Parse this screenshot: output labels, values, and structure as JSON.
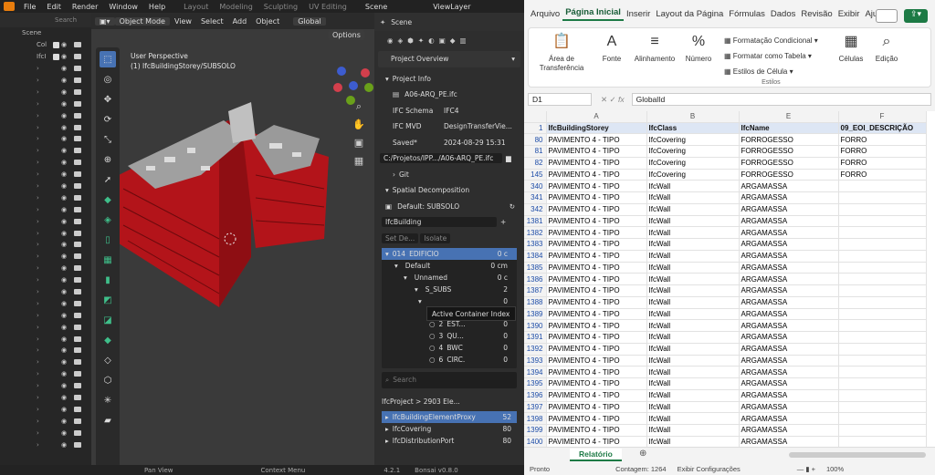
{
  "blender": {
    "menu": [
      "File",
      "Edit",
      "Render",
      "Window",
      "Help"
    ],
    "workspaces": [
      "Layout",
      "Modeling",
      "Sculpting",
      "UV Editing"
    ],
    "scene": "Scene",
    "view_layer": "ViewLayer",
    "outliner": {
      "search_placeholder": "Search",
      "rows": [
        "Scene",
        "Col",
        "IfcI"
      ]
    },
    "viewport_header": {
      "mode": "Object Mode",
      "menus": [
        "View",
        "Select",
        "Add",
        "Object"
      ],
      "orientation": "Global",
      "options": "Options"
    },
    "viewport_info": {
      "line1": "User Perspective",
      "line2": "(1) IfcBuildingStorey/SUBSOLO"
    },
    "status_bar": {
      "left": "Pan View",
      "mid": "Context Menu",
      "version": "4.2.1",
      "bonsai": "Bonsai v0.8.0"
    },
    "properties": {
      "header": "Scene",
      "tab": "Project Overview",
      "project_info": "Project Info",
      "file": "A06-ARQ_PE.ifc",
      "schema_label": "IFC Schema",
      "schema": "IFC4",
      "mvd_label": "IFC MVD",
      "mvd": "DesignTransferVie...",
      "saved_label": "Saved*",
      "saved": "2024-08-29 15:31",
      "path": "C:/Projetos/IPP.../A06-ARQ_PE.ifc",
      "git": "Git",
      "spatial": "Spatial Decomposition",
      "default_container": "Default: SUBSOLO",
      "ifc_building": "IfcBuilding",
      "set_default": "Set De...",
      "isolate": "Isolate",
      "tree": [
        {
          "id": "014",
          "name": "EDIFICIO",
          "val": "0 c"
        },
        {
          "id": "",
          "name": "Default",
          "val": "0 cm"
        },
        {
          "id": "",
          "name": "Unnamed",
          "val": "0 c"
        },
        {
          "id": "",
          "name": "S_SUBS",
          "val": "2"
        },
        {
          "id": "",
          "name": "",
          "val": "0"
        },
        {
          "id": "1",
          "name": "QU...",
          "val": "0"
        },
        {
          "id": "2",
          "name": "EST...",
          "val": "0"
        },
        {
          "id": "3",
          "name": "QU...",
          "val": "0"
        },
        {
          "id": "4",
          "name": "BWC",
          "val": "0"
        },
        {
          "id": "6",
          "name": "CIRC.",
          "val": "0"
        }
      ],
      "tooltip": "Active Container Index",
      "search_placeholder": "Search",
      "elements_header": "IfcProject > 2903 Ele...",
      "classes": [
        {
          "name": "IfcBuildingElementProxy",
          "count": "52"
        },
        {
          "name": "IfcCovering",
          "count": "80"
        },
        {
          "name": "IfcDistributionPort",
          "count": "80"
        }
      ]
    }
  },
  "excel": {
    "tabs": [
      "Arquivo",
      "Página Inicial",
      "Inserir",
      "Layout da Página",
      "Fórmulas",
      "Dados",
      "Revisão",
      "Exibir",
      "Ajuda"
    ],
    "ribbon": {
      "paste": "Área de Transferência",
      "font": "Fonte",
      "align": "Alinhamento",
      "number": "Número",
      "cond": "Formatação Condicional",
      "table": "Formatar como Tabela",
      "styles": "Estilos de Célula",
      "styles_group": "Estilos",
      "cells": "Células",
      "edit": "Edição"
    },
    "name_box": "D1",
    "formula": "GlobalId",
    "columns": [
      "A",
      "B",
      "E",
      "F"
    ],
    "headers": [
      "IfcBuildingStorey",
      "IfcClass",
      "IfcName",
      "09_EOI_DESCRIÇÃO"
    ],
    "rows": [
      [
        "80",
        "PAVIMENTO 4 - TIPO",
        "IfcCovering",
        "FORROGESSO",
        "FORRO"
      ],
      [
        "81",
        "PAVIMENTO 4 - TIPO",
        "IfcCovering",
        "FORROGESSO",
        "FORRO"
      ],
      [
        "82",
        "PAVIMENTO 4 - TIPO",
        "IfcCovering",
        "FORROGESSO",
        "FORRO"
      ],
      [
        "145",
        "PAVIMENTO 4 - TIPO",
        "IfcCovering",
        "FORROGESSO",
        "FORRO"
      ],
      [
        "340",
        "PAVIMENTO 4 - TIPO",
        "IfcWall",
        "ARGAMASSA",
        ""
      ],
      [
        "341",
        "PAVIMENTO 4 - TIPO",
        "IfcWall",
        "ARGAMASSA",
        ""
      ],
      [
        "342",
        "PAVIMENTO 4 - TIPO",
        "IfcWall",
        "ARGAMASSA",
        ""
      ],
      [
        "1381",
        "PAVIMENTO 4 - TIPO",
        "IfcWall",
        "ARGAMASSA",
        ""
      ],
      [
        "1382",
        "PAVIMENTO 4 - TIPO",
        "IfcWall",
        "ARGAMASSA",
        ""
      ],
      [
        "1383",
        "PAVIMENTO 4 - TIPO",
        "IfcWall",
        "ARGAMASSA",
        ""
      ],
      [
        "1384",
        "PAVIMENTO 4 - TIPO",
        "IfcWall",
        "ARGAMASSA",
        ""
      ],
      [
        "1385",
        "PAVIMENTO 4 - TIPO",
        "IfcWall",
        "ARGAMASSA",
        ""
      ],
      [
        "1386",
        "PAVIMENTO 4 - TIPO",
        "IfcWall",
        "ARGAMASSA",
        ""
      ],
      [
        "1387",
        "PAVIMENTO 4 - TIPO",
        "IfcWall",
        "ARGAMASSA",
        ""
      ],
      [
        "1388",
        "PAVIMENTO 4 - TIPO",
        "IfcWall",
        "ARGAMASSA",
        ""
      ],
      [
        "1389",
        "PAVIMENTO 4 - TIPO",
        "IfcWall",
        "ARGAMASSA",
        ""
      ],
      [
        "1390",
        "PAVIMENTO 4 - TIPO",
        "IfcWall",
        "ARGAMASSA",
        ""
      ],
      [
        "1391",
        "PAVIMENTO 4 - TIPO",
        "IfcWall",
        "ARGAMASSA",
        ""
      ],
      [
        "1392",
        "PAVIMENTO 4 - TIPO",
        "IfcWall",
        "ARGAMASSA",
        ""
      ],
      [
        "1393",
        "PAVIMENTO 4 - TIPO",
        "IfcWall",
        "ARGAMASSA",
        ""
      ],
      [
        "1394",
        "PAVIMENTO 4 - TIPO",
        "IfcWall",
        "ARGAMASSA",
        ""
      ],
      [
        "1395",
        "PAVIMENTO 4 - TIPO",
        "IfcWall",
        "ARGAMASSA",
        ""
      ],
      [
        "1396",
        "PAVIMENTO 4 - TIPO",
        "IfcWall",
        "ARGAMASSA",
        ""
      ],
      [
        "1397",
        "PAVIMENTO 4 - TIPO",
        "IfcWall",
        "ARGAMASSA",
        ""
      ],
      [
        "1398",
        "PAVIMENTO 4 - TIPO",
        "IfcWall",
        "ARGAMASSA",
        ""
      ],
      [
        "1399",
        "PAVIMENTO 4 - TIPO",
        "IfcWall",
        "ARGAMASSA",
        ""
      ],
      [
        "1400",
        "PAVIMENTO 4 - TIPO",
        "IfcWall",
        "ARGAMASSA",
        ""
      ]
    ],
    "sheet": "Relatório",
    "status": {
      "ready": "Pronto",
      "count": "Contagem: 1264",
      "display": "Exibir Configurações",
      "zoom": "100%"
    },
    "colors": {
      "accent": "#1d7a45",
      "header_fill": "#dde6f4"
    }
  }
}
